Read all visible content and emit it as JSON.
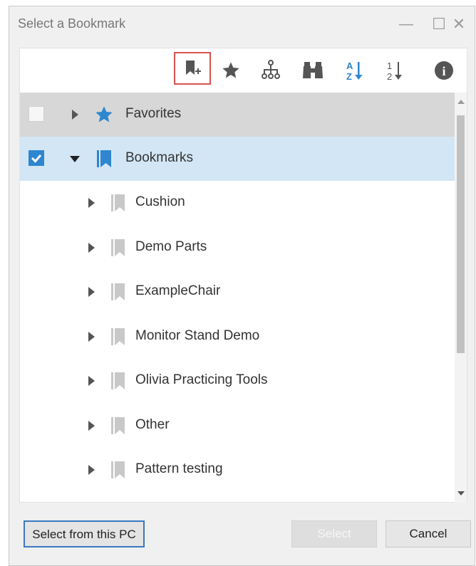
{
  "window": {
    "title": "Select a Bookmark",
    "minimize": "—",
    "maximize": "☐",
    "close": "✕"
  },
  "toolbar": {
    "buttons": [
      {
        "name": "add-bookmark",
        "icon": "bookmark-add-icon",
        "active": true
      },
      {
        "name": "favorites",
        "icon": "star-icon"
      },
      {
        "name": "hierarchy",
        "icon": "tree-hierarchy-icon"
      },
      {
        "name": "search",
        "icon": "binoculars-icon"
      },
      {
        "name": "sort-alphabetical",
        "icon": "sort-az-icon",
        "az_top": "A",
        "az_bottom": "Z"
      },
      {
        "name": "sort-numeric",
        "icon": "sort-12-icon",
        "n_top": "1",
        "n_bottom": "2"
      },
      {
        "name": "info",
        "icon": "info-icon",
        "glyph": "i"
      }
    ]
  },
  "tree": {
    "rows": [
      {
        "label": "Favorites",
        "icon": "star-icon",
        "checked": false,
        "expanded": false,
        "level": 0
      },
      {
        "label": "Bookmarks",
        "icon": "bookmark-icon",
        "checked": true,
        "expanded": true,
        "level": 0
      },
      {
        "label": "Cushion",
        "icon": "bookmark-icon",
        "level": 1
      },
      {
        "label": "Demo Parts",
        "icon": "bookmark-icon",
        "level": 1
      },
      {
        "label": "ExampleChair",
        "icon": "bookmark-icon",
        "level": 1
      },
      {
        "label": "Monitor Stand Demo",
        "icon": "bookmark-icon",
        "level": 1
      },
      {
        "label": "Olivia Practicing Tools",
        "icon": "bookmark-icon",
        "level": 1
      },
      {
        "label": "Other",
        "icon": "bookmark-icon",
        "level": 1
      },
      {
        "label": "Pattern testing",
        "icon": "bookmark-icon",
        "level": 1
      }
    ]
  },
  "footer": {
    "select_from_pc": "Select from this PC",
    "select": "Select",
    "cancel": "Cancel"
  },
  "colors": {
    "accent_blue": "#2e86cf",
    "selected_row": "#d3e6f5",
    "favorites_row": "#d7d7d7",
    "highlight_border": "#d9534f"
  }
}
